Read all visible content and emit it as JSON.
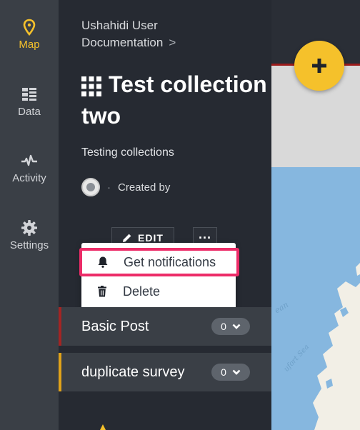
{
  "nav": {
    "items": [
      {
        "label": "Map",
        "icon": "map-pin-icon",
        "active": true
      },
      {
        "label": "Data",
        "icon": "data-list-icon",
        "active": false
      },
      {
        "label": "Activity",
        "icon": "activity-pulse-icon",
        "active": false
      },
      {
        "label": "Settings",
        "icon": "gear-icon",
        "active": false
      }
    ]
  },
  "collection": {
    "breadcrumb": "Ushahidi User Documentation",
    "breadcrumb_separator": ">",
    "title": "Test collection two",
    "description": "Testing collections",
    "created_by_label": "Created by",
    "edit_label": "EDIT",
    "more_label": "···"
  },
  "menu": {
    "items": [
      {
        "label": "Get notifications",
        "icon": "bell-icon",
        "highlighted": true
      },
      {
        "label": "Delete",
        "icon": "trash-icon",
        "highlighted": false
      }
    ]
  },
  "posts": [
    {
      "name": "Basic Post",
      "count": "0",
      "color": "#a32424"
    },
    {
      "name": "duplicate survey",
      "count": "0",
      "color": "#e0a21a"
    }
  ],
  "map": {
    "fab_label": "+",
    "labels": [
      "ean",
      "ufort Sea"
    ]
  },
  "colors": {
    "accent": "#f5c12b",
    "highlight": "#ec2c68",
    "rail": "#3a3f46",
    "panel": "#262a32",
    "water": "#86b7df"
  }
}
